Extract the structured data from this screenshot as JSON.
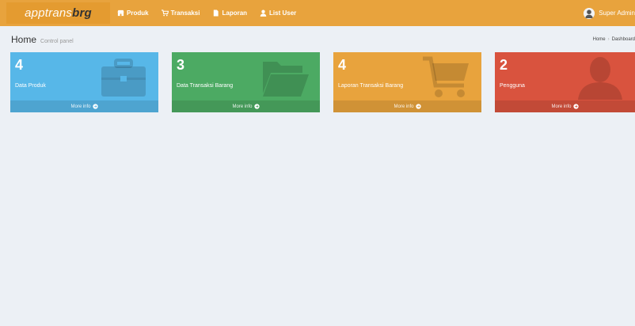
{
  "brand": {
    "part1": "apptrans",
    "part2": "brg"
  },
  "nav": {
    "items": [
      {
        "label": "Produk",
        "icon": "shop-icon"
      },
      {
        "label": "Transaksi",
        "icon": "cart-icon"
      },
      {
        "label": "Laporan",
        "icon": "file-icon"
      },
      {
        "label": "List User",
        "icon": "user-icon"
      }
    ]
  },
  "user": {
    "name": "Super Admin",
    "icon": "avatar-icon"
  },
  "header": {
    "title": "Home",
    "subtitle": "Control panel",
    "breadcrumb": [
      "Home",
      "Dashboard"
    ]
  },
  "boxes": [
    {
      "count": "4",
      "label": "Data Produk",
      "footer": "More info",
      "icon": "briefcase-icon",
      "color": "#57b7e8"
    },
    {
      "count": "3",
      "label": "Data Transaksi Barang",
      "footer": "More info",
      "icon": "folder-open-icon",
      "color": "#4caa63"
    },
    {
      "count": "4",
      "label": "Laporan Transaksi Barang",
      "footer": "More info",
      "icon": "cart-icon",
      "color": "#e8a33d"
    },
    {
      "count": "2",
      "label": "Pengguna",
      "footer": "More info",
      "icon": "user-icon",
      "color": "#d9533e"
    }
  ],
  "colors": {
    "navbar": "#e8a33d",
    "background": "#ecf0f5"
  }
}
